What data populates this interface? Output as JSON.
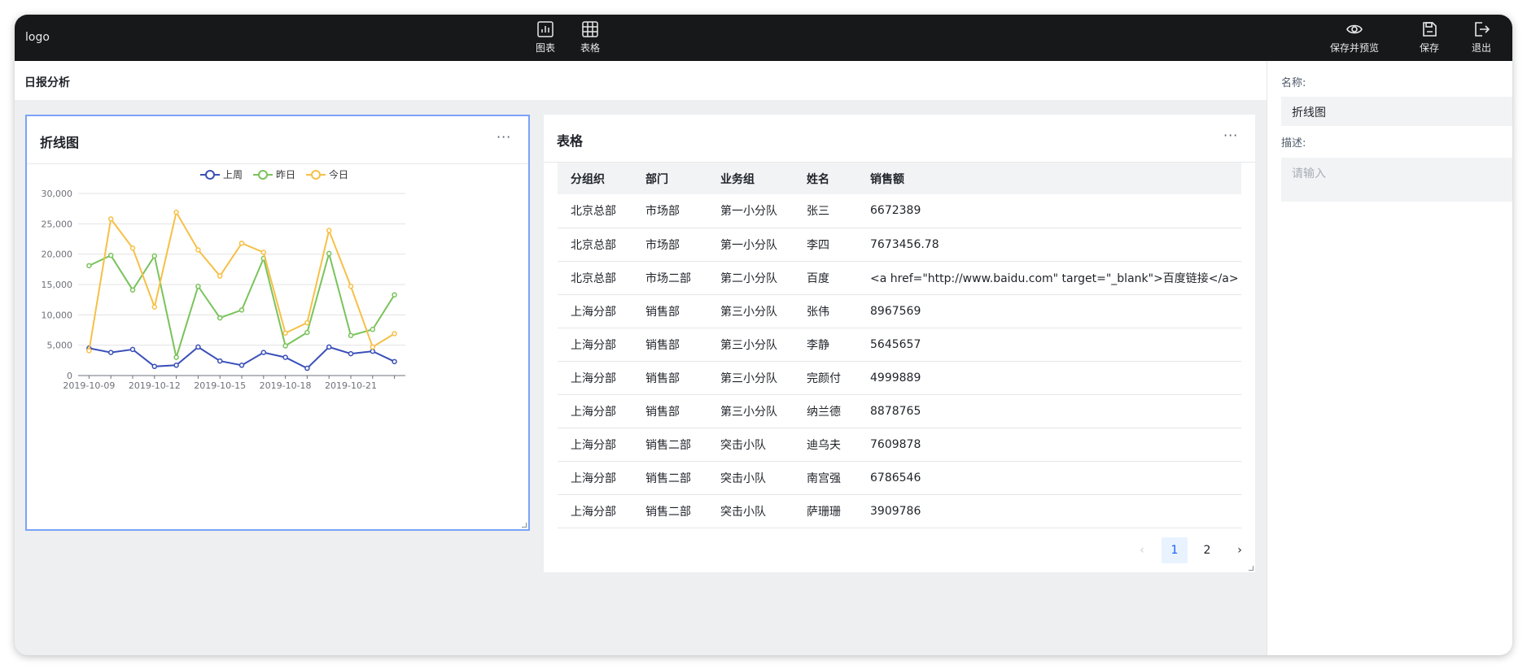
{
  "topbar": {
    "logo": "logo",
    "center_buttons": [
      {
        "label": "图表",
        "icon": "bar-chart-icon"
      },
      {
        "label": "表格",
        "icon": "table-icon"
      }
    ],
    "right_buttons": [
      {
        "label": "保存并预览",
        "icon": "eye-icon"
      },
      {
        "label": "保存",
        "icon": "save-icon"
      },
      {
        "label": "退出",
        "icon": "exit-icon"
      }
    ]
  },
  "page": {
    "title": "日报分析"
  },
  "right_panel": {
    "name_label": "名称:",
    "name_value": "折线图",
    "desc_label": "描述:",
    "desc_placeholder": "请输入"
  },
  "chart_card": {
    "title": "折线图",
    "more": "···"
  },
  "table_card": {
    "title": "表格",
    "more": "···",
    "columns": [
      "分组织",
      "部门",
      "业务组",
      "姓名",
      "销售额"
    ],
    "rows": [
      [
        "北京总部",
        "市场部",
        "第一小分队",
        "张三",
        "6672389"
      ],
      [
        "北京总部",
        "市场部",
        "第一小分队",
        "李四",
        "7673456.78"
      ],
      [
        "北京总部",
        "市场二部",
        "第二小分队",
        "百度",
        "<a href=\"http://www.baidu.com\" target=\"_blank\">百度链接</a>"
      ],
      [
        "上海分部",
        "销售部",
        "第三小分队",
        "张伟",
        "8967569"
      ],
      [
        "上海分部",
        "销售部",
        "第三小分队",
        "李静",
        "5645657"
      ],
      [
        "上海分部",
        "销售部",
        "第三小分队",
        "完颜付",
        "4999889"
      ],
      [
        "上海分部",
        "销售部",
        "第三小分队",
        "纳兰德",
        "8878765"
      ],
      [
        "上海分部",
        "销售二部",
        "突击小队",
        "迪乌夫",
        "7609878"
      ],
      [
        "上海分部",
        "销售二部",
        "突击小队",
        "南宫强",
        "6786546"
      ],
      [
        "上海分部",
        "销售二部",
        "突击小队",
        "萨珊珊",
        "3909786"
      ]
    ],
    "pagination": {
      "prev": "‹",
      "pages": [
        "1",
        "2"
      ],
      "current": "1",
      "next": "›"
    }
  },
  "chart_data": {
    "type": "line",
    "x": [
      "2019-10-09",
      "2019-10-10",
      "2019-10-11",
      "2019-10-12",
      "2019-10-13",
      "2019-10-14",
      "2019-10-15",
      "2019-10-16",
      "2019-10-17",
      "2019-10-18",
      "2019-10-19",
      "2019-10-20",
      "2019-10-21",
      "2019-10-22",
      "2019-10-23"
    ],
    "x_tick_labels": [
      "2019-10-09",
      "2019-10-12",
      "2019-10-15",
      "2019-10-18",
      "2019-10-21"
    ],
    "y_ticks": [
      0,
      5000,
      10000,
      15000,
      20000,
      25000,
      30000
    ],
    "y_tick_labels": [
      "0",
      "5,000",
      "10,000",
      "15,000",
      "20,000",
      "25,000",
      "30,000"
    ],
    "ylim": [
      0,
      30000
    ],
    "grid": true,
    "legend_position": "top",
    "series": [
      {
        "name": "上周",
        "color": "#3a4fb8",
        "values": [
          4500,
          3800,
          4300,
          1500,
          1700,
          4700,
          2400,
          1700,
          3800,
          3000,
          1200,
          4700,
          3600,
          4000,
          2300
        ]
      },
      {
        "name": "昨日",
        "color": "#7ac35b",
        "values": [
          18100,
          19800,
          14100,
          19700,
          3000,
          14700,
          9500,
          10800,
          19300,
          4900,
          7100,
          20100,
          6600,
          7600,
          13300
        ]
      },
      {
        "name": "今日",
        "color": "#f6c046",
        "values": [
          4100,
          25800,
          21000,
          11300,
          26900,
          20700,
          16400,
          21800,
          20300,
          7000,
          8700,
          23900,
          14700,
          4700,
          6900
        ]
      }
    ]
  }
}
